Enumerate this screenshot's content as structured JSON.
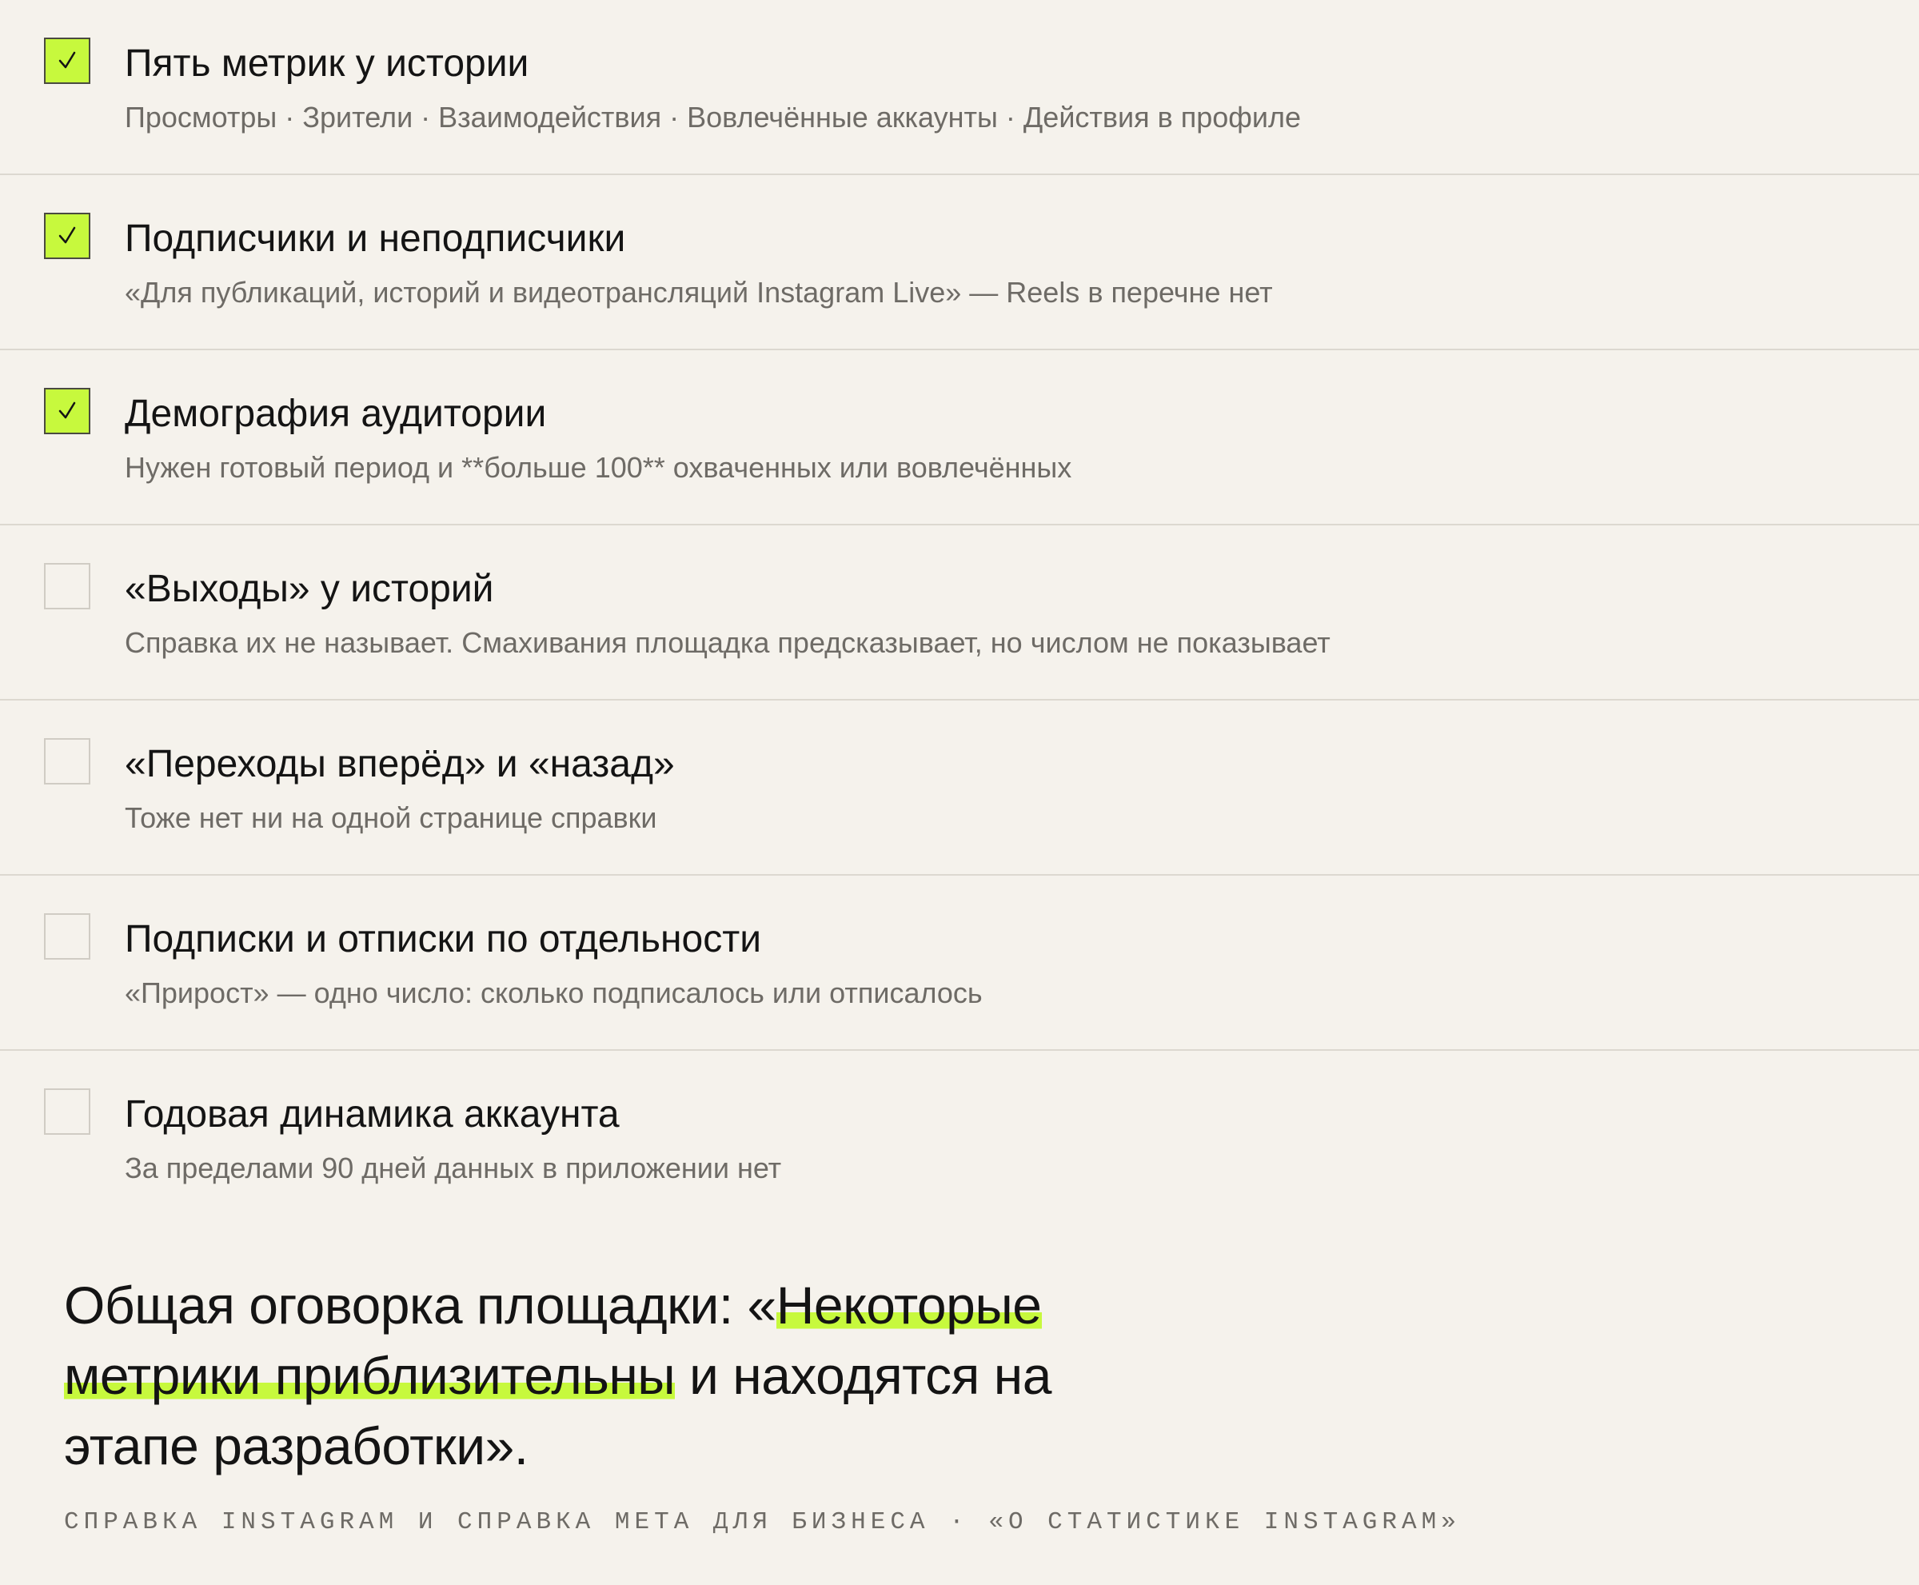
{
  "colors": {
    "background": "#f5f2ec",
    "accent": "#c7f93d",
    "text": "#141414",
    "muted": "#6e6b66",
    "divider": "#dcd8d0"
  },
  "items": [
    {
      "checked": true,
      "title": "Пять метрик у истории",
      "desc": "Просмотры · Зрители · Взаимодействия · Вовлечённые аккаунты · Действия в профиле"
    },
    {
      "checked": true,
      "title": "Подписчики и неподписчики",
      "desc": "«Для публикаций, историй и видеотрансляций Instagram Live» — Reels в перечне нет"
    },
    {
      "checked": true,
      "title": "Демография аудитории",
      "desc": "Нужен готовый период и **больше 100** охваченных или вовлечённых"
    },
    {
      "checked": false,
      "title": "«Выходы» у историй",
      "desc": "Справка их не называет. Смахивания площадка предсказывает, но числом не показывает"
    },
    {
      "checked": false,
      "title": "«Переходы вперёд» и «назад»",
      "desc": "Тоже нет ни на одной странице справки"
    },
    {
      "checked": false,
      "title": "Подписки и отписки по отдельности",
      "desc": "«Прирост» — одно число: сколько подписалось или отписалось"
    },
    {
      "checked": false,
      "title": "Годовая динамика аккаунта",
      "desc": "За пределами 90 дней данных в приложении нет"
    }
  ],
  "quote": {
    "before": "Общая оговорка площадки: «",
    "highlight": "Некоторые метрики приблизительны",
    "after": " и находятся на этапе разработки»."
  },
  "source": "СПРАВКА INSTAGRAM И СПРАВКА МЕТА ДЛЯ БИЗНЕСА · «О СТАТИСТИКЕ INSTAGRAM»"
}
